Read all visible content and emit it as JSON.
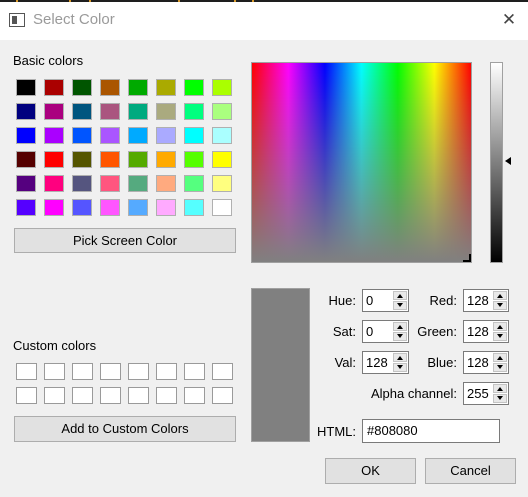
{
  "window": {
    "title": "Select Color",
    "close_glyph": "✕",
    "icon": "app-window-icon"
  },
  "basic": {
    "label": "Basic colors",
    "rows": [
      [
        "#000000",
        "#aa0000",
        "#005500",
        "#aa5500",
        "#00aa00",
        "#aaaa00",
        "#00ff00",
        "#aaff00"
      ],
      [
        "#00007f",
        "#aa007f",
        "#00557f",
        "#aa557f",
        "#00aa7f",
        "#aaaa7f",
        "#00ff7f",
        "#aaff7f"
      ],
      [
        "#0000ff",
        "#aa00ff",
        "#0055ff",
        "#aa55ff",
        "#00aaff",
        "#aaaaff",
        "#00ffff",
        "#aaffff"
      ],
      [
        "#550000",
        "#ff0000",
        "#555500",
        "#ff5500",
        "#55aa00",
        "#ffaa00",
        "#55ff00",
        "#ffff00"
      ],
      [
        "#55007f",
        "#ff007f",
        "#55557f",
        "#ff557f",
        "#55aa7f",
        "#ffaa7f",
        "#55ff7f",
        "#ffff7f"
      ],
      [
        "#5500ff",
        "#ff00ff",
        "#5555ff",
        "#ff55ff",
        "#55aaff",
        "#ffaaff",
        "#55ffff",
        "#ffffff"
      ]
    ]
  },
  "pick_button": "Pick Screen Color",
  "custom": {
    "label": "Custom colors",
    "slot_count": 16,
    "add_button": "Add to Custom Colors"
  },
  "current_color": "#808080",
  "fields": {
    "hue": {
      "label": "Hue:",
      "value": "0"
    },
    "sat": {
      "label": "Sat:",
      "value": "0"
    },
    "val": {
      "label": "Val:",
      "value": "128"
    },
    "red": {
      "label": "Red:",
      "value": "128"
    },
    "green": {
      "label": "Green:",
      "value": "128"
    },
    "blue": {
      "label": "Blue:",
      "value": "128"
    },
    "alpha": {
      "label": "Alpha channel:",
      "value": "255"
    },
    "html": {
      "label": "HTML:",
      "value": "#808080"
    }
  },
  "buttons": {
    "ok": "OK",
    "cancel": "Cancel"
  }
}
